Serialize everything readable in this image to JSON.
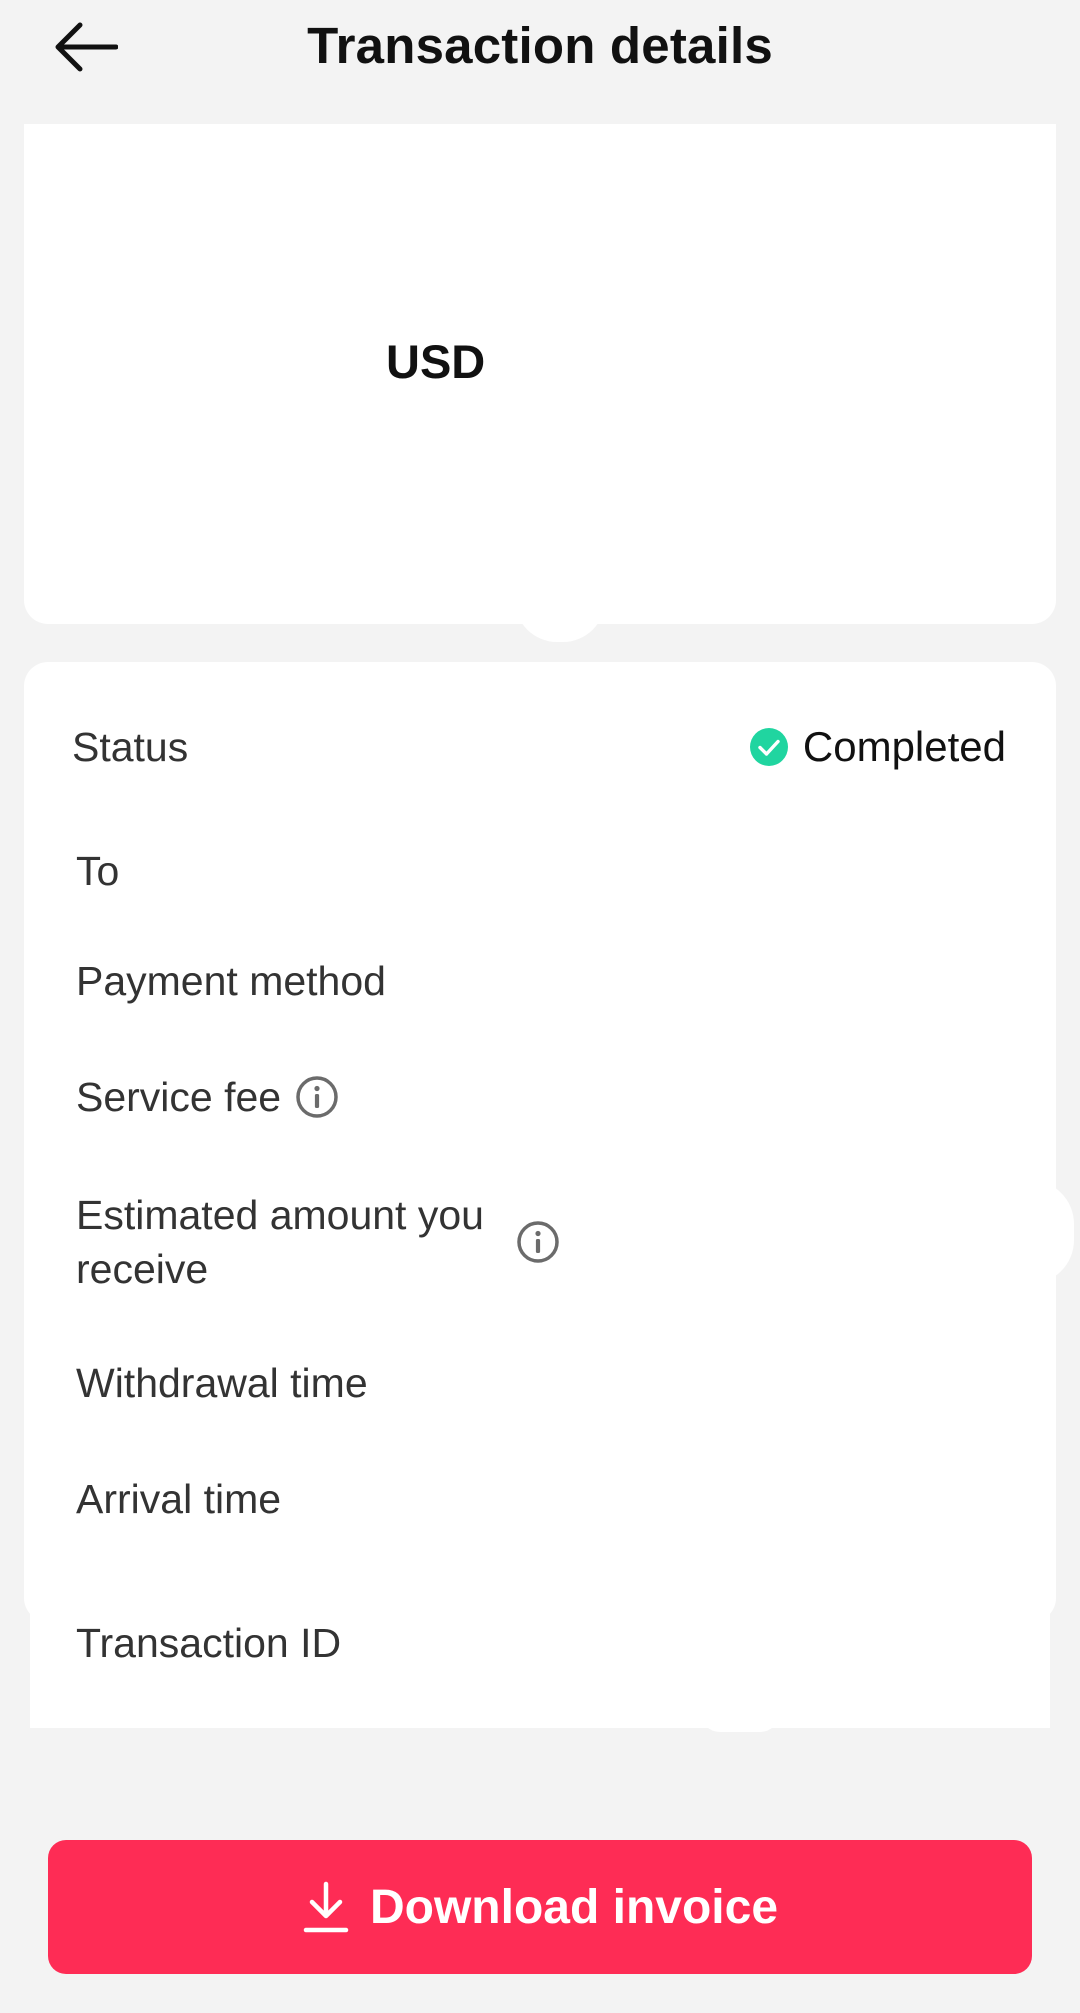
{
  "header": {
    "title": "Transaction details",
    "back_icon": "arrow-left-icon"
  },
  "amount_card": {
    "currency": "USD"
  },
  "details": {
    "status": {
      "label": "Status",
      "value": "Completed",
      "color": "#20d5a0"
    },
    "to_label": "To",
    "payment_method_label": "Payment method",
    "service_fee_label": "Service fee",
    "estimated_amount_label": "Estimated amount you receive",
    "withdrawal_time_label": "Withdrawal time",
    "arrival_time_label": "Arrival time",
    "transaction_id_label": "Transaction ID",
    "info_icon": "info-icon"
  },
  "download": {
    "label": "Download invoice",
    "icon": "download-icon",
    "color": "#fe2c55"
  }
}
